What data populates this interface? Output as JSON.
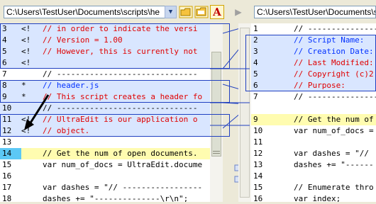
{
  "toolbar": {
    "left_path": "C:\\Users\\TestUser\\Documents\\scripts\\he",
    "right_path": "C:\\Users\\TestUser\\Documents\\s",
    "dropdown_glyph": "▼",
    "font_glyph": "A",
    "compare_glyph": "▶"
  },
  "left_lines": [
    {
      "num": "3",
      "mark": "<!",
      "code": "// in order to indicate the versi",
      "style": "cmt",
      "bg": "#d9e6ff"
    },
    {
      "num": "4",
      "mark": "<!",
      "code": "// Version = 1.00",
      "style": "cmt",
      "bg": "#d9e6ff"
    },
    {
      "num": "5",
      "mark": "<!",
      "code": "// However, this is currently not",
      "style": "cmt",
      "bg": "#d9e6ff"
    },
    {
      "num": "6",
      "mark": "<!",
      "code": "",
      "style": "plain",
      "bg": "#d9e6ff"
    },
    {
      "num": "7",
      "mark": "",
      "code": "// ------------------------------",
      "style": "plain",
      "bg": "#ffffff"
    },
    {
      "num": "8",
      "mark": "*",
      "code": "// header.js",
      "style": "cmtb",
      "bg": "#d9e6ff"
    },
    {
      "num": "9",
      "mark": "*",
      "code": "// This script creates a header fo",
      "style": "cmt",
      "bg": "#d9e6ff"
    },
    {
      "num": "10",
      "mark": "",
      "code": "// ------------------------------",
      "style": "plain",
      "bg": "#d9e6ff"
    },
    {
      "num": "11",
      "mark": "<!",
      "code": "// UltraEdit is our application o",
      "style": "cmt",
      "bg": "#d9e6ff"
    },
    {
      "num": "12",
      "mark": "<!",
      "code": "// object.",
      "style": "cmt",
      "bg": "#d9e6ff"
    },
    {
      "num": "13",
      "mark": "",
      "code": "",
      "style": "plain",
      "bg": "#ffffff"
    },
    {
      "num": "14",
      "mark": "",
      "code": "// Get the num of open documents.",
      "style": "plain",
      "bg": "#fffcb0"
    },
    {
      "num": "15",
      "mark": "",
      "code": "var num_of_docs = UltraEdit.docume",
      "style": "plain",
      "bg": "#ffffff"
    },
    {
      "num": "16",
      "mark": "",
      "code": "",
      "style": "plain",
      "bg": "#ffffff"
    },
    {
      "num": "17",
      "mark": "",
      "code": "var dashes = \"// -----------------",
      "style": "plain",
      "bg": "#ffffff"
    },
    {
      "num": "18",
      "mark": "",
      "code": "dashes += \"--------------\\r\\n\";",
      "style": "plain",
      "bg": "#ffffff"
    }
  ],
  "right_lines": [
    {
      "num": "1",
      "code": "// ------------------------",
      "style": "plain",
      "bg": "#ffffff"
    },
    {
      "num": "2",
      "code": "// Script Name:",
      "style": "cmtb",
      "bg": "#d9e6ff"
    },
    {
      "num": "3",
      "code": "// Creation Date:",
      "style": "cmtb",
      "bg": "#d9e6ff"
    },
    {
      "num": "4",
      "code": "// Last Modified:",
      "style": "cmt",
      "bg": "#d9e6ff"
    },
    {
      "num": "5",
      "code": "// Copyright (c)2",
      "style": "cmt",
      "bg": "#d9e6ff"
    },
    {
      "num": "6",
      "code": "// Purpose:",
      "style": "cmt",
      "bg": "#d9e6ff"
    },
    {
      "num": "7",
      "code": "// ------------------------",
      "style": "plain",
      "bg": "#ffffff"
    },
    {
      "num": "",
      "code": "",
      "style": "plain",
      "bg": "#ffffff"
    },
    {
      "num": "9",
      "code": "// Get the num of",
      "style": "plain",
      "bg": "#fffcb0"
    },
    {
      "num": "10",
      "code": "var num_of_docs =",
      "style": "plain",
      "bg": "#ffffff"
    },
    {
      "num": "11",
      "code": "",
      "style": "plain",
      "bg": "#ffffff"
    },
    {
      "num": "12",
      "code": "var dashes = \"//",
      "style": "plain",
      "bg": "#ffffff"
    },
    {
      "num": "13",
      "code": "dashes += \"------",
      "style": "plain",
      "bg": "#ffffff"
    },
    {
      "num": "14",
      "code": "",
      "style": "plain",
      "bg": "#ffffff"
    },
    {
      "num": "15",
      "code": "// Enumerate thro",
      "style": "plain",
      "bg": "#ffffff"
    },
    {
      "num": "16",
      "code": "var index;",
      "style": "plain",
      "bg": "#ffffff"
    }
  ],
  "colors": {
    "cursor_line_gutter": "#5cc8f5",
    "highlight": "#d9e6ff",
    "match": "#fffcb0",
    "link": "#2040c0"
  }
}
